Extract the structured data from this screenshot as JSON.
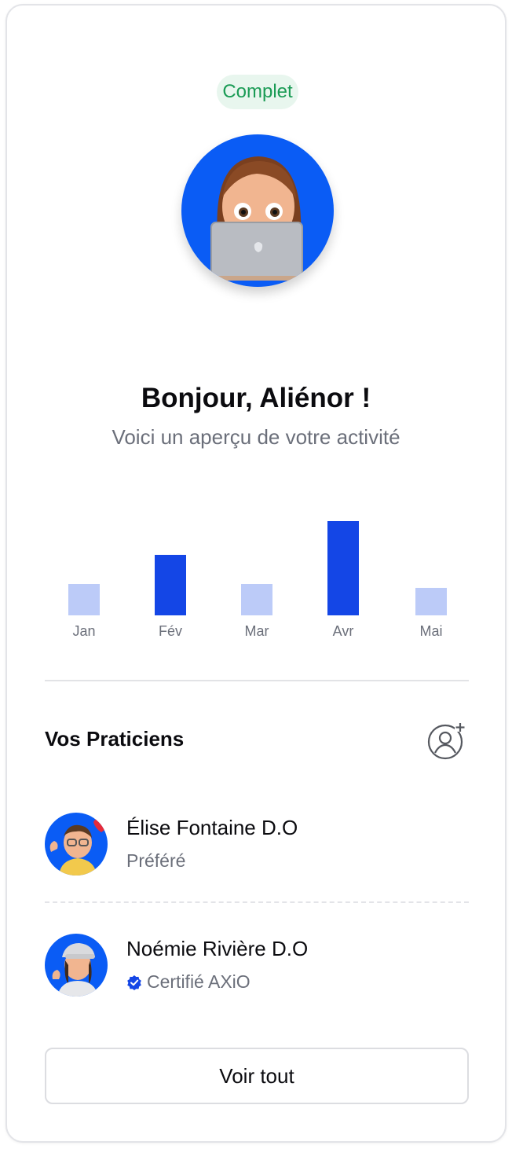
{
  "status_badge": "Complet",
  "greeting": "Bonjour, Aliénor !",
  "subtitle": "Voici un aperçu de votre activité",
  "colors": {
    "accent": "#1446e6",
    "accent_light": "#bccbf8",
    "badge_bg": "#e8f6ee",
    "badge_text": "#1a9b55",
    "avatar_bg": "#0a5cf5"
  },
  "chart_data": {
    "type": "bar",
    "categories": [
      "Jan",
      "Fév",
      "Mar",
      "Avr",
      "Mai"
    ],
    "values": [
      33,
      64,
      33,
      100,
      29
    ],
    "highlighted": [
      false,
      true,
      false,
      true,
      false
    ],
    "ylim": [
      0,
      100
    ],
    "title": "",
    "xlabel": "",
    "ylabel": ""
  },
  "practitioners": {
    "title": "Vos Praticiens",
    "add_icon": "add-user-icon",
    "items": [
      {
        "name": "Élise Fontaine D.O",
        "tag": "Préféré",
        "verified": false
      },
      {
        "name": "Noémie Rivière D.O",
        "tag": "Certifié AXiO",
        "verified": true
      }
    ]
  },
  "see_all_label": "Voir tout"
}
